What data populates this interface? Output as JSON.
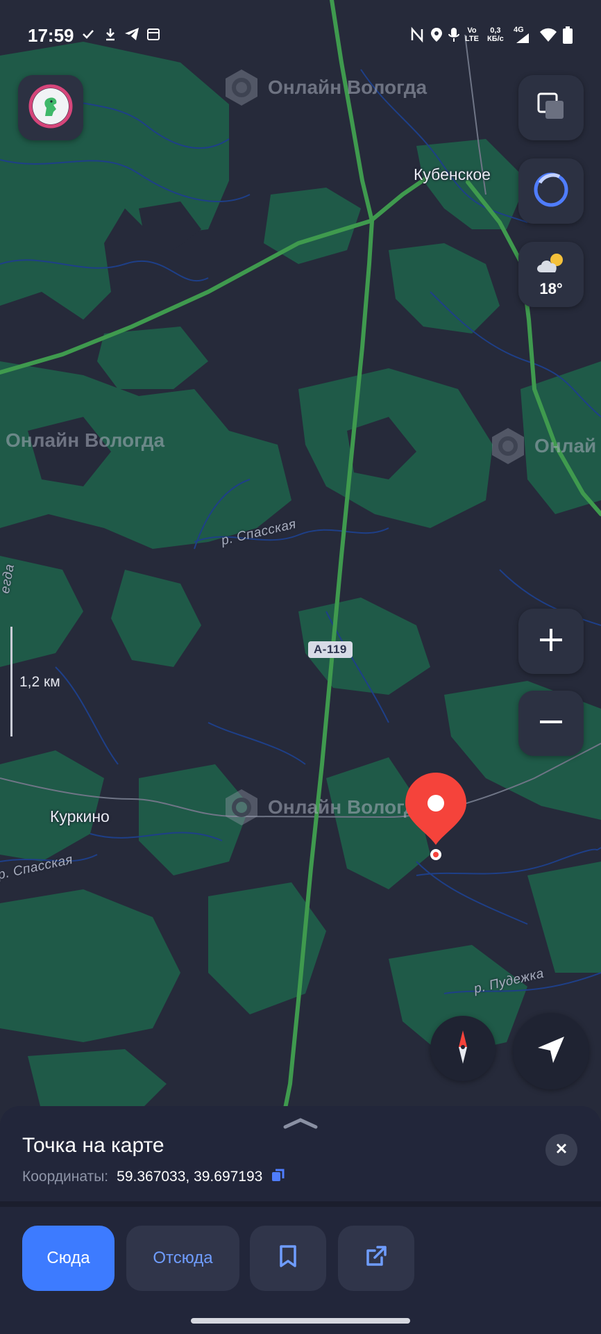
{
  "status_bar": {
    "time": "17:59",
    "network_top": "0,3",
    "network_unit": "КБ/с",
    "volte_top": "Vo",
    "volte_bottom": "LTE",
    "cell_gen": "4G",
    "icons_left": [
      "download-icon",
      "telegram-icon",
      "calendar-icon"
    ],
    "icons_right": [
      "nfc-icon",
      "location-icon",
      "mic-icon",
      "signal-icon",
      "wifi-icon",
      "battery-icon"
    ]
  },
  "map": {
    "places": {
      "kubenskoe": "Кубенское",
      "kurkino": "Куркино"
    },
    "rivers": {
      "spasskaya_1": "р. Спасская",
      "spasskaya_2": "р. Спасская",
      "pudezhka": "р. Пудежка",
      "vologda_edge": "егда"
    },
    "road_number": "А-119",
    "watermark": "Онлайн Вологда",
    "watermark_cut": "Онлай",
    "colors": {
      "land": "#262a3a",
      "forest": "#1f5a48",
      "roads_major": "#3f9a4e",
      "rivers": "#1e3f88",
      "pin": "#f5433b"
    }
  },
  "weather": {
    "temperature": "18°",
    "icon": "partly-cloudy-icon"
  },
  "scale": {
    "label": "1,2 км"
  },
  "place_card": {
    "title": "Точка на карте",
    "coords_label": "Координаты:",
    "coords_value": "59.367033, 39.697193"
  },
  "actions": {
    "here": "Сюда",
    "from": "Отсюда"
  }
}
